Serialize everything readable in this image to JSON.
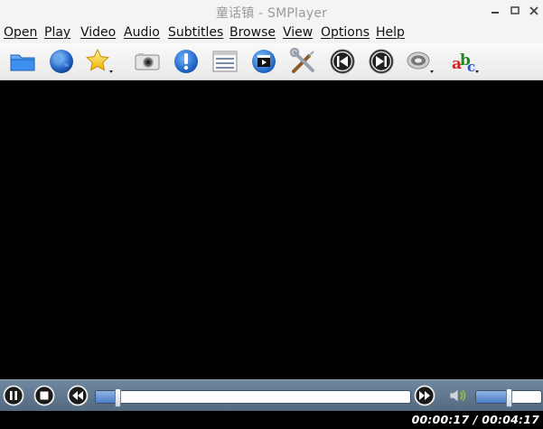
{
  "window": {
    "title": "童话镇 - SMPlayer"
  },
  "menu": [
    {
      "label": "Open"
    },
    {
      "label": "Play"
    },
    {
      "label": "Video"
    },
    {
      "label": "Audio"
    },
    {
      "label": "Subtitles"
    },
    {
      "label": "Browse"
    },
    {
      "label": "View"
    },
    {
      "label": "Options"
    },
    {
      "label": "Help"
    }
  ],
  "toolbar": {
    "icons": [
      "open-folder-icon",
      "globe-icon",
      "favorites-star-icon",
      "screenshot-camera-icon",
      "info-icon",
      "playlist-icon",
      "video-preferences-icon",
      "tools-icon",
      "previous-icon",
      "next-icon",
      "audio-track-icon",
      "subtitle-icon"
    ]
  },
  "player": {
    "progress": 0.068,
    "volume": 0.5,
    "time_display": "00:00:17 / 00:04:17"
  },
  "colors": {
    "control_bar": "#5f7890",
    "accent": "#4a7fc8"
  }
}
